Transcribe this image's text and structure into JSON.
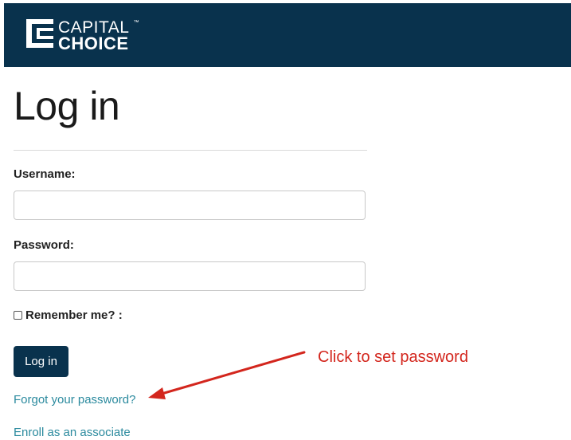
{
  "brand": {
    "line1": "CAPITAL",
    "trademark": "™",
    "line2": "CHOICE",
    "header_color": "#09324d"
  },
  "page_title": "Log in",
  "form": {
    "username_label": "Username:",
    "username_value": "",
    "password_label": "Password:",
    "password_value": "",
    "remember_label": "Remember me? :",
    "remember_checked": false,
    "submit_label": "Log in"
  },
  "links": {
    "forgot_password": "Forgot your password?",
    "enroll": "Enroll as an associate",
    "link_color": "#2b8a9e"
  },
  "annotation": {
    "text": "Click to set password",
    "color": "#d3261d"
  }
}
